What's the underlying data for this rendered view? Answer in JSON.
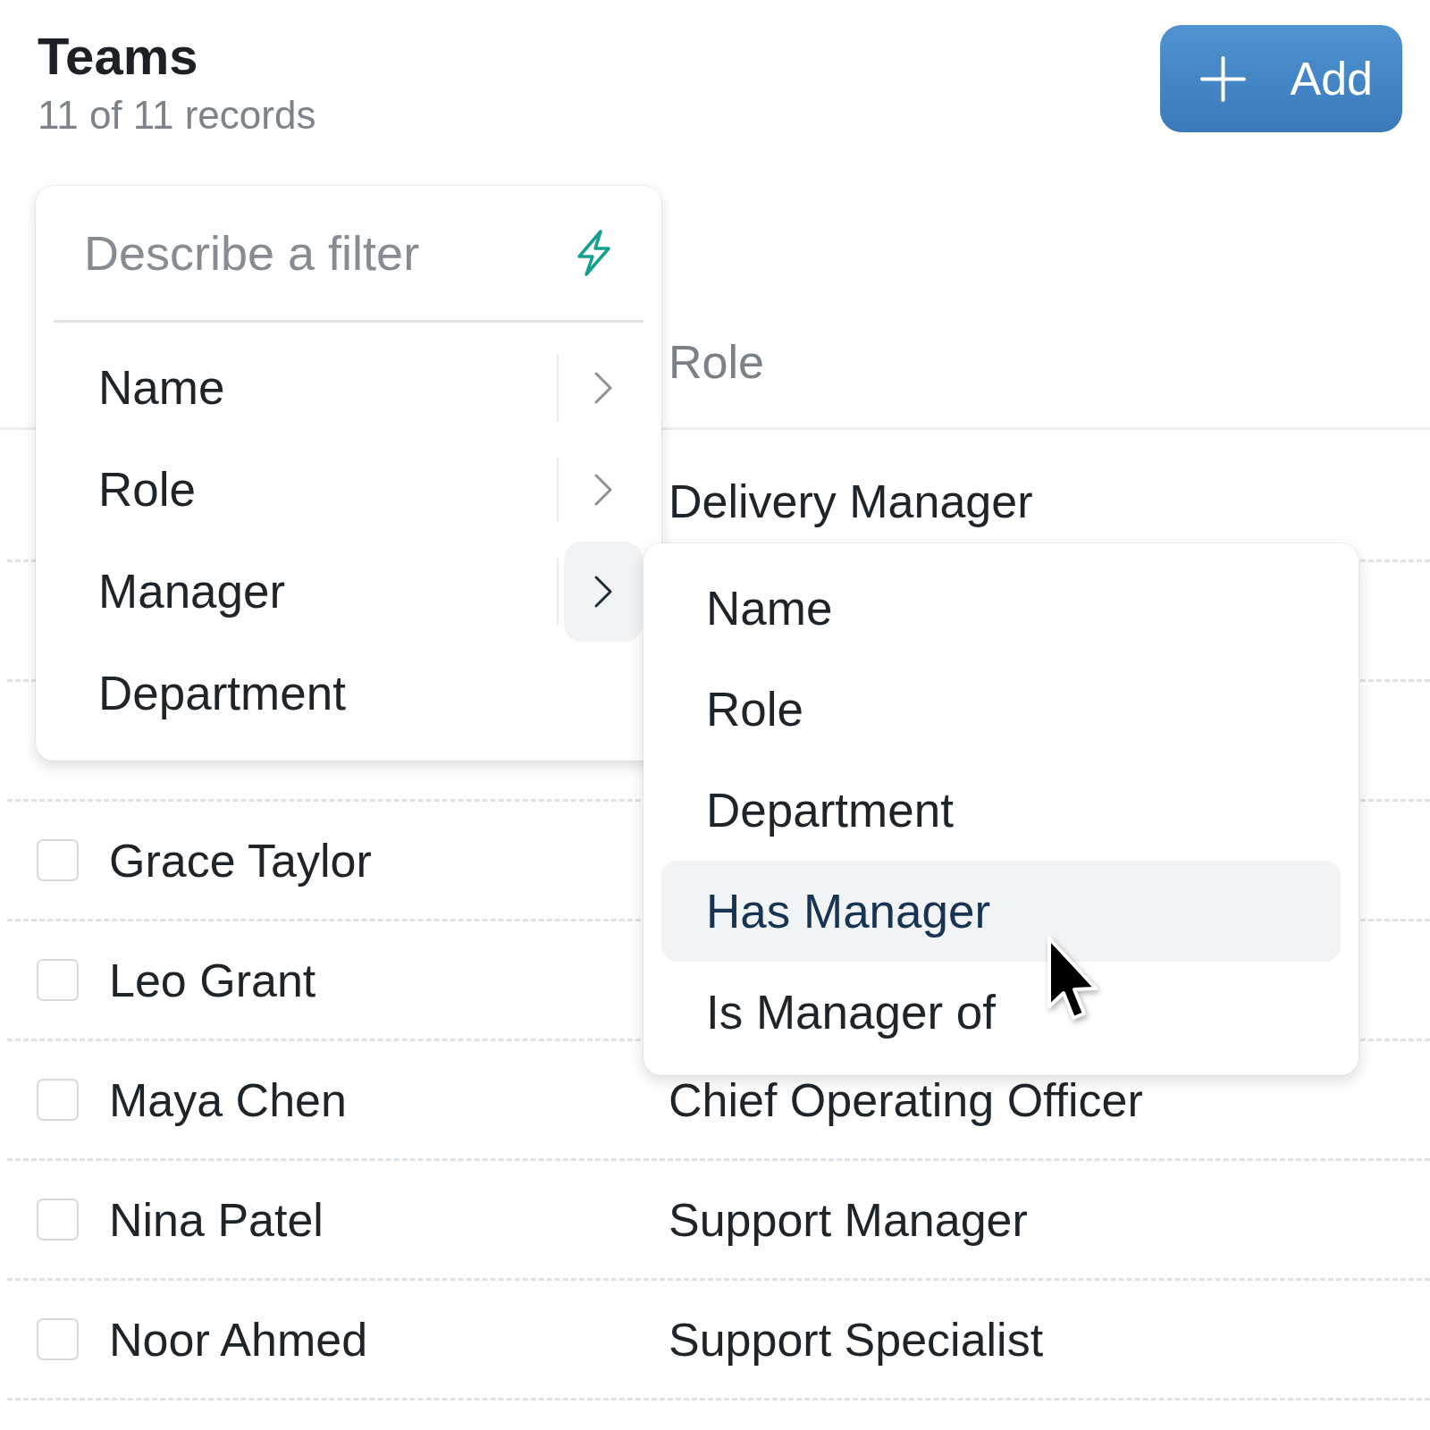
{
  "header": {
    "title": "Teams",
    "record_count": "11 of 11 records",
    "add_button": {
      "label": "Add"
    }
  },
  "table": {
    "role_header": "Role",
    "rows": [
      {
        "role": "Delivery Manager"
      },
      {},
      {},
      {
        "checked": false,
        "column_1": "Grace Taylor"
      },
      {
        "checked": false,
        "column_1": "Leo Grant"
      },
      {
        "checked": false,
        "column_1": "Maya Chen",
        "role": "Chief Operating Officer"
      },
      {
        "checked": false,
        "column_1": "Nina Patel",
        "role": "Support Manager"
      },
      {
        "checked": false,
        "column_1": "Noor Ahmed",
        "role": "Support Specialist"
      }
    ]
  },
  "filter_menu": {
    "placeholder": "Describe a filter",
    "items": [
      {
        "kind": "submenu",
        "label": "Name",
        "expanded": false
      },
      {
        "kind": "submenu",
        "label": "Role",
        "expanded": false
      },
      {
        "kind": "submenu",
        "label": "Manager",
        "expanded": true
      },
      {
        "kind": "plain",
        "label": "Department",
        "expanded": false
      }
    ]
  },
  "submenu": {
    "items": [
      {
        "label": "Name",
        "selected": false
      },
      {
        "label": "Role",
        "selected": false
      },
      {
        "label": "Department",
        "selected": false
      },
      {
        "label": "Has Manager",
        "selected": true
      },
      {
        "label": "Is Manager of",
        "selected": false
      }
    ]
  }
}
